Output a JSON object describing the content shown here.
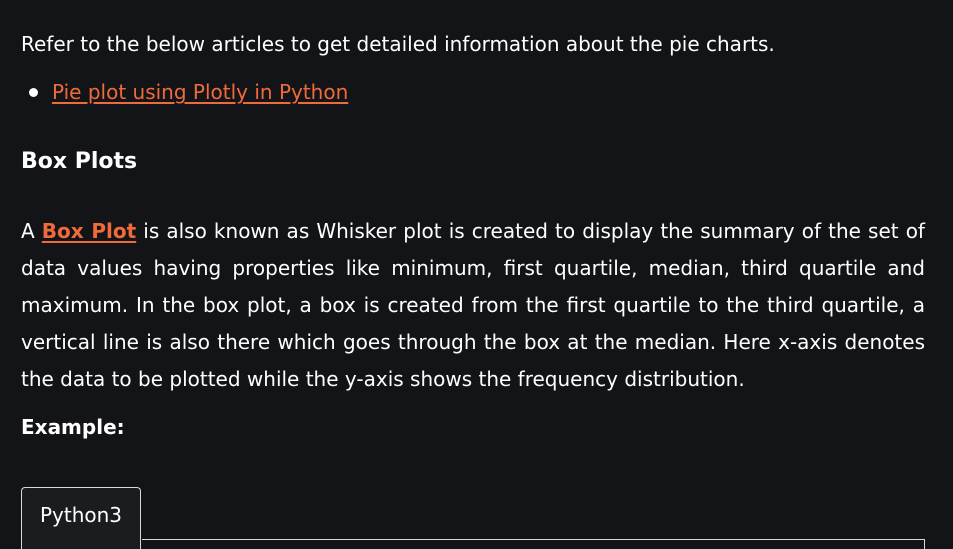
{
  "intro": {
    "text": "Refer to the below articles to get detailed information about the pie charts."
  },
  "links": [
    {
      "label": "Pie plot using Plotly in Python"
    }
  ],
  "section": {
    "heading": "Box Plots",
    "para_prefix": "A ",
    "para_link": "Box Plot",
    "para_rest": " is also known as Whisker plot is created to display the summary of the set of data values having properties like minimum, first quartile, median, third quartile and maximum. In the box plot, a box is created from the first quartile to the third quartile, a vertical line is also there which goes through the box at the median. Here x-axis denotes the data to be plotted while the y-axis shows the frequency distribution."
  },
  "example": {
    "label": "Example:"
  },
  "code_tabs": [
    {
      "label": "Python3"
    }
  ],
  "colors": {
    "background": "#131417",
    "text": "#ffffff",
    "link": "#ef6b3c"
  }
}
